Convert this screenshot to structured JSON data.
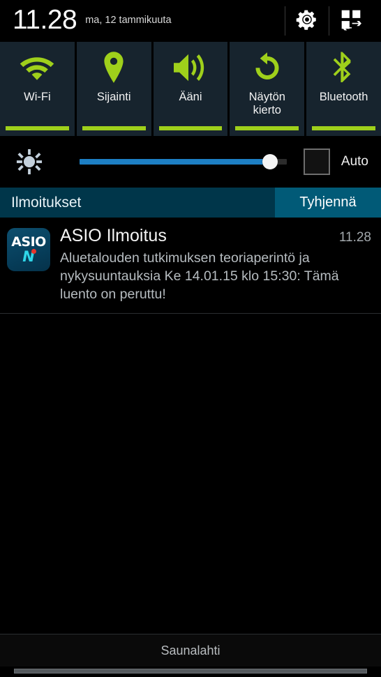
{
  "header": {
    "time": "11.28",
    "date": "ma, 12 tammikuuta",
    "settings_icon": "gear-icon",
    "quick_toggle_icon": "quick-settings-grid-icon"
  },
  "quick_tiles": [
    {
      "label": "Wi-Fi",
      "icon": "wifi-icon",
      "state": "on",
      "accent": "#9fd01b"
    },
    {
      "label": "Sijainti",
      "icon": "location-pin-icon",
      "state": "on",
      "accent": "#9fd01b"
    },
    {
      "label": "Ääni",
      "icon": "sound-speaker-icon",
      "state": "on",
      "accent": "#9fd01b"
    },
    {
      "label": "Näytön\nkierto",
      "icon": "screen-rotate-icon",
      "state": "on",
      "accent": "#9fd01b"
    },
    {
      "label": "Bluetooth",
      "icon": "bluetooth-icon",
      "state": "on",
      "accent": "#9fd01b"
    }
  ],
  "brightness": {
    "icon": "brightness-sun-icon",
    "value_percent": 92,
    "slider_color": "#1d7fc4",
    "auto_label": "Auto",
    "auto_checked": false
  },
  "notifications_panel": {
    "title": "Ilmoitukset",
    "clear_label": "Tyhjennä",
    "clear_bg": "#015a77",
    "header_bg": "#00364a"
  },
  "notifications": [
    {
      "app_icon": "asio-app-icon",
      "icon_text_top": "ASIO",
      "icon_text_bottom": "N",
      "app_name": "ASIO Ilmoitus",
      "time": "11.28",
      "message": "Aluetalouden tutkimuksen teoriaperintö ja nykysuuntauksia Ke 14.01.15 klo 15:30: Tämä luento on peruttu!"
    }
  ],
  "footer": {
    "carrier": "Saunalahti",
    "handle": "drag-handle"
  }
}
